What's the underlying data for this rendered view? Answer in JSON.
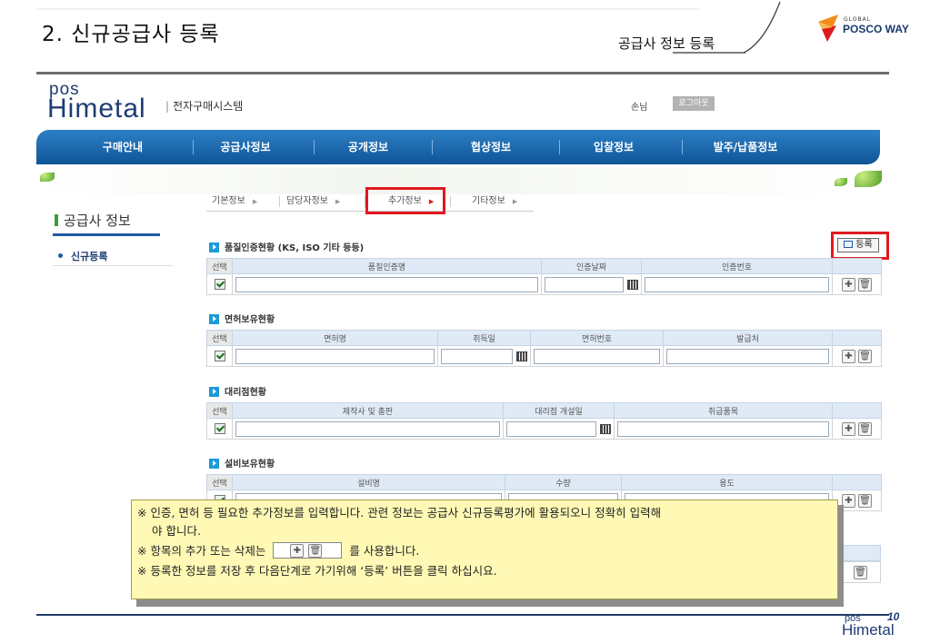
{
  "slide": {
    "title": "2. 신규공급사 등록",
    "subtitle": "공급사 정보 등록",
    "corp_logo_global": "GLOBAL",
    "corp_logo_name": "POSCO WAY",
    "page_number": "10",
    "footer_logo_pos": "pos",
    "footer_logo_himetal": "Himetal"
  },
  "app": {
    "brand_pos": "pos",
    "brand_himetal": "Himetal",
    "system_name": "전자구매시스템",
    "user_label": "손님",
    "logout_label": "로그아웃"
  },
  "gnb": {
    "items": [
      "구매안내",
      "공급사정보",
      "공개정보",
      "협상정보",
      "입찰정보",
      "발주/납품정보"
    ]
  },
  "lnb": {
    "title": "공급사 정보",
    "items": [
      "신규등록"
    ]
  },
  "steps": [
    "기본정보",
    "담당자정보",
    "추가정보",
    "기타정보"
  ],
  "register_button": "등록",
  "sections": {
    "quality": {
      "title": "품질인증현황 (KS, ISO 기타 등등)",
      "headers": [
        "선택",
        "품질인증명",
        "인증날짜",
        "인증번호",
        ""
      ]
    },
    "license": {
      "title": "면허보유현황",
      "headers": [
        "선택",
        "면허명",
        "취득일",
        "면허번호",
        "발급처",
        ""
      ]
    },
    "agency": {
      "title": "대리점현황",
      "headers": [
        "선택",
        "제작사 및 총판",
        "대리점 개설일",
        "취급품목",
        ""
      ]
    },
    "equipment": {
      "title": "설비보유현황",
      "headers": [
        "선택",
        "설비명",
        "수량",
        "용도",
        ""
      ]
    }
  },
  "icons": {
    "add": "plus-icon",
    "delete": "trash-icon",
    "calendar": "calendar-icon"
  },
  "note": {
    "line1": "※ 인증, 면허 등 필요한 추가정보를 입력합니다. 관련 정보는 공급사 신규등록평가에 활용되오니 정확히 입력해",
    "line1b": "야 합니다.",
    "line2_pre": "※ 항목의 추가 또는 삭제는",
    "line2_post": "를 사용합니다.",
    "line3": "※ 등록한 정보를 저장 후 다음단계로 가기위해 ‘등록’ 버튼을 클릭 하십시요."
  }
}
